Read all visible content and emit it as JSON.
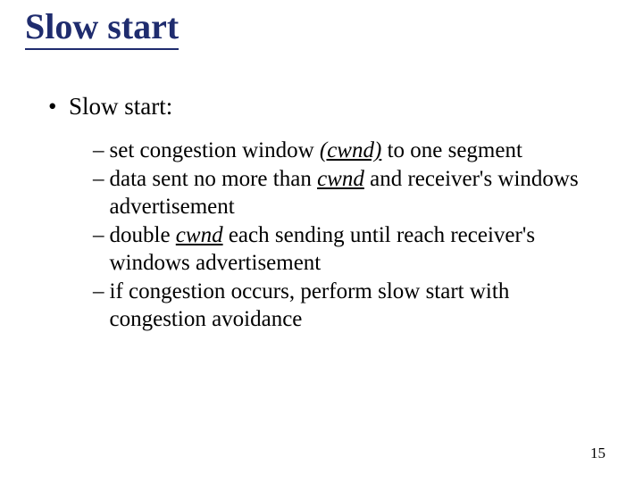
{
  "title": "Slow start",
  "bullet1": {
    "marker": "•",
    "text": "Slow start:"
  },
  "sub": {
    "dash": "–",
    "items": [
      {
        "pre": "set congestion window  ",
        "em": "(cwnd)",
        "post": " to one segment"
      },
      {
        "pre": "data sent no more than ",
        "em": "cwnd",
        "post": " and  receiver's windows advertisement"
      },
      {
        "pre": "double ",
        "em": "cwnd",
        "post": " each sending until reach receiver's windows advertisement"
      },
      {
        "pre": "if congestion occurs, perform slow start with congestion avoidance",
        "em": "",
        "post": ""
      }
    ]
  },
  "pagenum": "15"
}
